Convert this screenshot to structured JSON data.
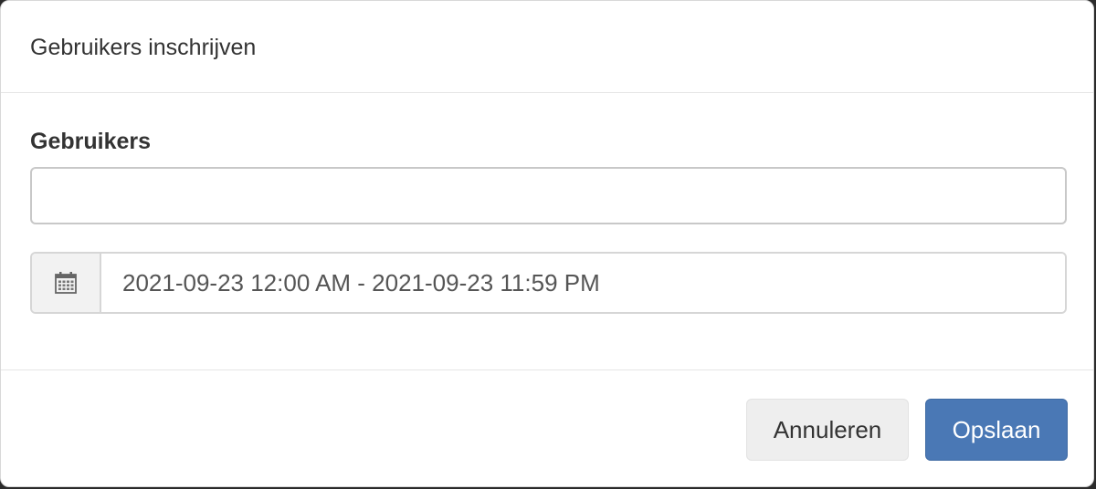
{
  "modal": {
    "title": "Gebruikers inschrijven"
  },
  "form": {
    "users_label": "Gebruikers",
    "users_value": "",
    "users_placeholder": "",
    "daterange_value": "2021-09-23 12:00 AM - 2021-09-23 11:59 PM",
    "calendar_icon": "calendar-icon"
  },
  "footer": {
    "cancel_label": "Annuleren",
    "save_label": "Opslaan"
  },
  "colors": {
    "primary": "#4a78b5",
    "default_button": "#eeeeee",
    "addon_background": "#f2f2f2"
  }
}
